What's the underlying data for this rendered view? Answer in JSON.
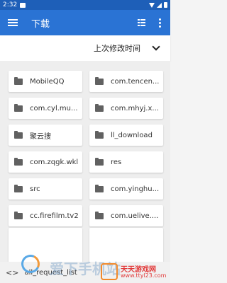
{
  "status": {
    "time": "2:32"
  },
  "appbar": {
    "title": "下载"
  },
  "sort": {
    "label": "上次修改时间"
  },
  "files": [
    {
      "name": "MobileQQ"
    },
    {
      "name": "com.tencen..."
    },
    {
      "name": "com.cyl.mu..."
    },
    {
      "name": "com.mhyj.x..."
    },
    {
      "name": "聚云搜"
    },
    {
      "name": "ll_download"
    },
    {
      "name": "com.zqgk.wkl"
    },
    {
      "name": "res"
    },
    {
      "name": "src"
    },
    {
      "name": "com.yinghu..."
    },
    {
      "name": "cc.firefilm.tv2"
    },
    {
      "name": "com.uelive...."
    }
  ],
  "bottom": {
    "code_icon": "<>",
    "file_name": "all_request_list"
  },
  "watermark": {
    "text": "爱下手机站",
    "badge_title": "天天游戏网",
    "badge_sub": "www.ttyl23.com"
  },
  "colors": {
    "statusbar": "#1e5fb8",
    "appbar": "#2a73d4",
    "background": "#eeeeee"
  },
  "icons": {
    "menu": "hamburger-menu-icon",
    "view": "list-view-icon",
    "more": "more-vert-icon",
    "sort": "chevron-down-icon",
    "folder": "folder-icon",
    "code": "code-icon"
  }
}
